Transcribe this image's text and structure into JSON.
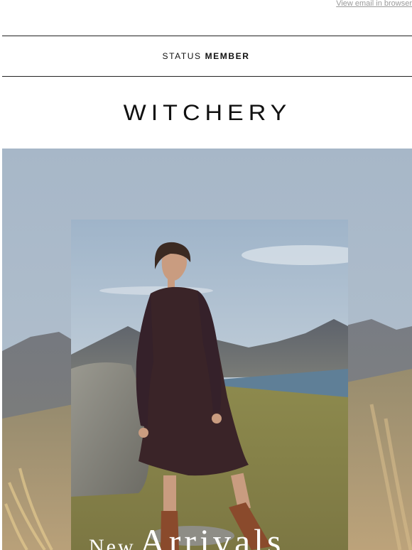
{
  "header": {
    "view_in_browser": "View email in browser",
    "status_prefix": "STATUS",
    "status_strong": "MEMBER",
    "brand": "WITCHERY"
  },
  "hero": {
    "headline_word1": "New",
    "headline_word2": "Arrivals"
  },
  "colors": {
    "sky": "#a9b8c8",
    "frame_sky": "#b7c7d8",
    "grass": "#8d8a4a",
    "dress": "#3a2428",
    "boots": "#8a4a2c",
    "text_dark": "#111111"
  }
}
